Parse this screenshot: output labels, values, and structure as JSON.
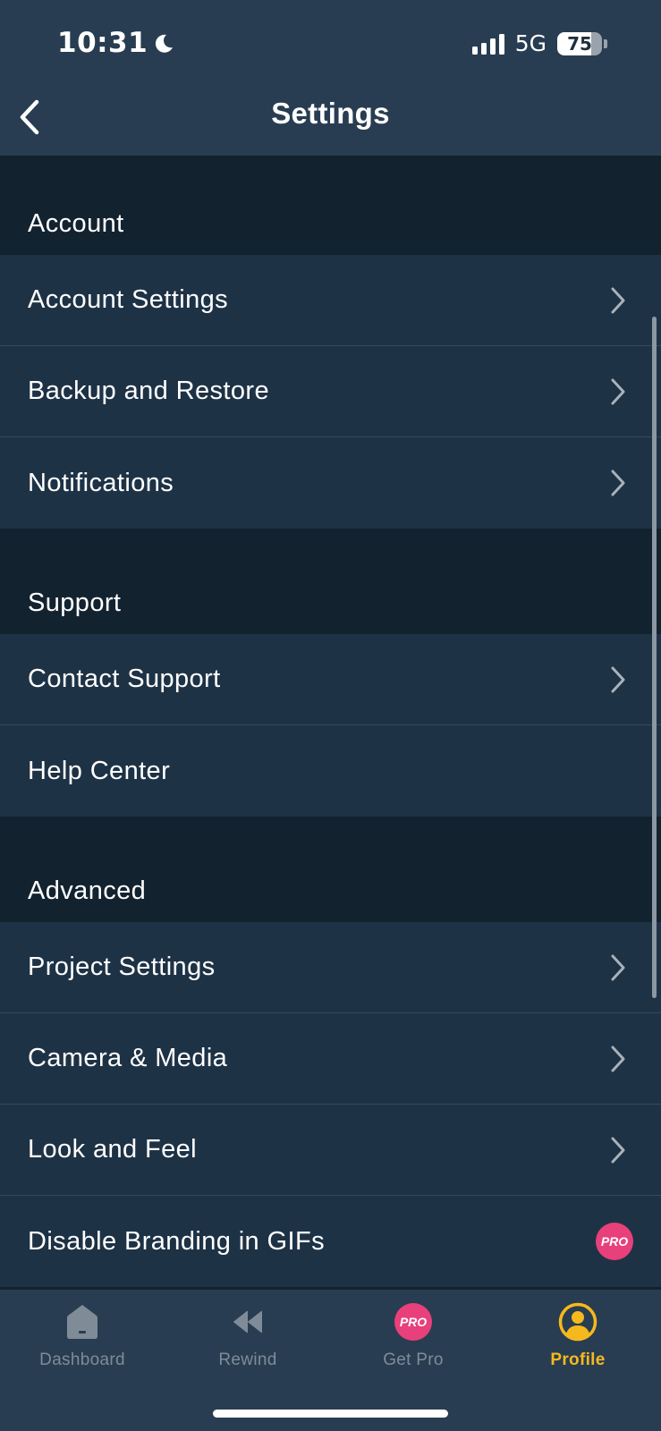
{
  "status_bar": {
    "time": "10:31",
    "network": "5G",
    "battery_percent": 75,
    "battery_label": "75",
    "signal_bars": 4
  },
  "header": {
    "title": "Settings",
    "back_icon": "chevron-left-icon"
  },
  "sections": [
    {
      "title": "Account",
      "items": [
        {
          "label": "Account Settings",
          "trailing": "chevron-right-icon"
        },
        {
          "label": "Backup and Restore",
          "trailing": "chevron-right-icon"
        },
        {
          "label": "Notifications",
          "trailing": "chevron-right-icon"
        }
      ]
    },
    {
      "title": "Support",
      "items": [
        {
          "label": "Contact Support",
          "trailing": "chevron-right-icon"
        },
        {
          "label": "Help Center",
          "trailing": "none"
        }
      ]
    },
    {
      "title": "Advanced",
      "items": [
        {
          "label": "Project Settings",
          "trailing": "chevron-right-icon"
        },
        {
          "label": "Camera & Media",
          "trailing": "chevron-right-icon"
        },
        {
          "label": "Look and Feel",
          "trailing": "chevron-right-icon"
        },
        {
          "label": "Disable Branding in GIFs",
          "trailing": "pro-badge-icon",
          "badge_text": "PRO"
        }
      ]
    }
  ],
  "tab_bar": {
    "tabs": [
      {
        "label": "Dashboard",
        "icon": "home-icon",
        "active": false
      },
      {
        "label": "Rewind",
        "icon": "rewind-icon",
        "active": false
      },
      {
        "label": "Get Pro",
        "icon": "pro-badge-icon",
        "badge_text": "PRO",
        "active": false
      },
      {
        "label": "Profile",
        "icon": "profile-icon",
        "active": true
      }
    ]
  },
  "colors": {
    "header_bg": "#283d51",
    "section_bg": "#13222f",
    "row_bg": "#1e3246",
    "accent_active": "#f5b91d",
    "pro_badge": "#e8407a",
    "inactive_tab": "#7f8c98"
  }
}
